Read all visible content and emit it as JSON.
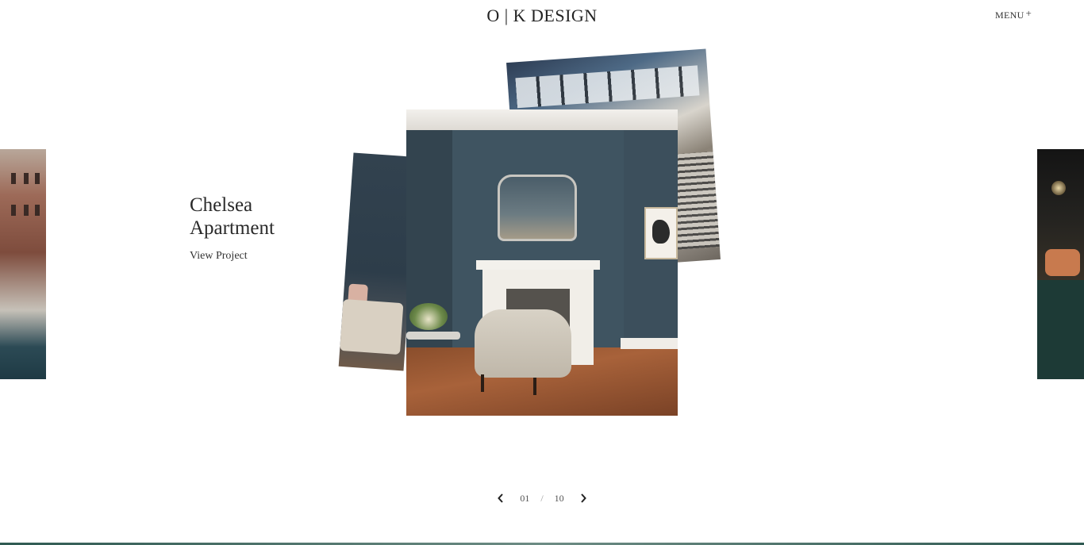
{
  "header": {
    "logo": "O | K DESIGN",
    "menu_label": "MENU",
    "menu_icon": "plus-icon",
    "menu_icon_glyph": "+"
  },
  "project": {
    "title": "Chelsea Apartment",
    "link_label": "View Project"
  },
  "pagination": {
    "current": "01",
    "separator": "/",
    "total": "10",
    "prev_icon": "chevron-left-icon",
    "next_icon": "chevron-right-icon"
  },
  "colors": {
    "accent_line": "#2f5a52",
    "text": "#2a2a2a"
  }
}
